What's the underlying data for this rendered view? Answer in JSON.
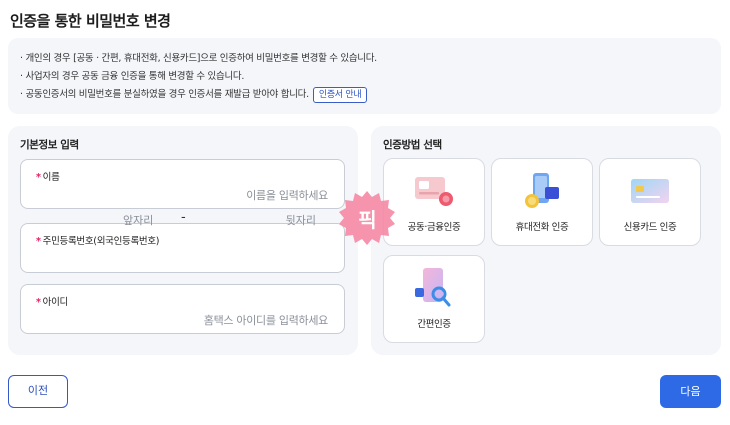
{
  "page": {
    "title": "인증을 통한 비밀번호 변경"
  },
  "notice": {
    "lines": [
      "· 개인의 경우 [공동 · 간편, 휴대전화, 신용카드]으로 인증하여 비밀번호를 변경할 수 있습니다.",
      "· 사업자의 경우  공동  금융 인증을 통해 변경할 수 있습니다.",
      "· 공동인증서의 비밀번호를 분실하였을 경우 인증서를 재발급 받아야 합니다."
    ],
    "cert_guide_button": "인증서 안내"
  },
  "basic_info": {
    "title": "기본정보 입력",
    "required_mark": "*",
    "name": {
      "label": "이름",
      "placeholder": "이름을 입력하세요"
    },
    "ssn": {
      "label": "주민등록번호(외국인등록번호)",
      "front_placeholder": "앞자리",
      "separator": "-",
      "back_placeholder": "뒷자리"
    },
    "user_id": {
      "label": "아이디",
      "placeholder": "홈택스 아이디를 입력하세요"
    }
  },
  "auth_method": {
    "title": "인증방법 선택",
    "options": [
      {
        "label": "공동·금융인증",
        "icon": "certificate-card-icon"
      },
      {
        "label": "휴대전화 인증",
        "icon": "mobile-phone-icon"
      },
      {
        "label": "신용카드 인증",
        "icon": "credit-card-icon"
      },
      {
        "label": "간편인증",
        "icon": "simple-auth-icon"
      }
    ]
  },
  "pick_badge": {
    "text": "픽"
  },
  "nav": {
    "prev": "이전",
    "next": "다음"
  },
  "colors": {
    "primary": "#2e6ae6",
    "outline": "#3559c7",
    "required": "#e0245e",
    "badge": "#f47a9b",
    "panel_bg": "#f4f6fa"
  }
}
